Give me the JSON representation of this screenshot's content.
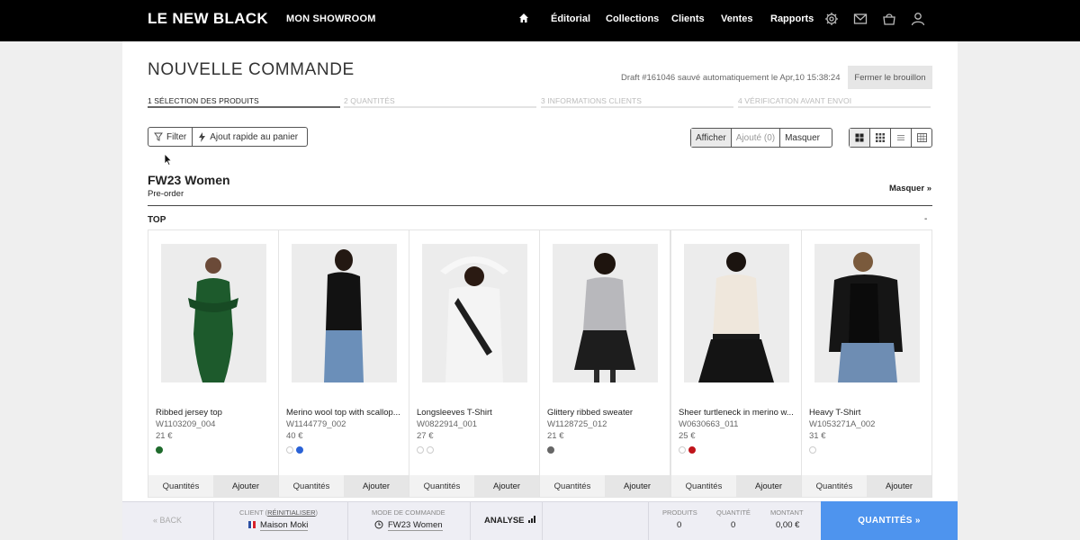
{
  "topbar": {
    "logo": "LE NEW BLACK",
    "showroom": "MON SHOWROOM",
    "nav": [
      "Éditorial",
      "Collections",
      "Clients",
      "Ventes",
      "Rapports"
    ],
    "icons": [
      "home-icon",
      "gear-icon",
      "inbox-icon",
      "cart-icon",
      "user-icon"
    ]
  },
  "header": {
    "title": "NOUVELLE COMMANDE",
    "draft_status": "Draft #161046 sauvé automatiquement le Apr,10 15:38:24",
    "close_draft": "Fermer le brouillon"
  },
  "steps": [
    {
      "label": "1 SÉLECTION DES PRODUITS",
      "active": true
    },
    {
      "label": "2 QUANTITÉS",
      "active": false
    },
    {
      "label": "3 INFORMATIONS CLIENTS",
      "active": false
    },
    {
      "label": "4 VÉRIFICATION AVANT ENVOI",
      "active": false
    }
  ],
  "toolbar": {
    "filter": "Filter",
    "quick_add": "Ajout rapide au panier",
    "show": "Afficher",
    "added": "Ajouté (0)",
    "hide": "Masquer",
    "layouts": [
      "grid-large-icon",
      "grid-small-icon",
      "list-icon",
      "table-icon"
    ]
  },
  "collection": {
    "title": "FW23 Women",
    "subtitle": "Pre-order",
    "hide_link": "Masquer »",
    "category": "TOP",
    "category_toggle": "-"
  },
  "products": [
    {
      "name": "Ribbed jersey top",
      "ref": "W1103209_004",
      "price": "21 €",
      "swatches": [
        "#1f6b2c"
      ]
    },
    {
      "name": "Merino wool top with scallop...",
      "ref": "W1144779_002",
      "price": "40 €",
      "swatches": [
        "#ffffff",
        "#2a62d6"
      ]
    },
    {
      "name": "Longsleeves T-Shirt",
      "ref": "W0822914_001",
      "price": "27 €",
      "swatches": [
        "#ffffff",
        "#ffffff"
      ]
    },
    {
      "name": "Glittery ribbed sweater",
      "ref": "W1128725_012",
      "price": "21 €",
      "swatches": [
        "#666666"
      ]
    },
    {
      "name": "Sheer turtleneck in merino w...",
      "ref": "W0630663_011",
      "price": "25 €",
      "swatches": [
        "#ffffff",
        "#c0141b"
      ]
    },
    {
      "name": "Heavy T-Shirt",
      "ref": "W1053271A_002",
      "price": "31 €",
      "swatches": [
        "#ffffff"
      ]
    }
  ],
  "card_actions": {
    "quantities": "Quantités",
    "add": "Ajouter"
  },
  "bottombar": {
    "back": "« BACK",
    "client_label": "CLIENT",
    "client_reset": "RÉINITIALISER",
    "client_name": "Maison Moki",
    "mode_label": "MODE DE COMMANDE",
    "mode_value": "FW23 Women",
    "analyse": "ANALYSE",
    "products_label": "PRODUITS",
    "products_value": "0",
    "qty_label": "QUANTITÉ",
    "qty_value": "0",
    "amount_label": "MONTANT",
    "amount_value": "0,00 €",
    "cta": "QUANTITÉS »"
  },
  "colors": {
    "accent": "#4e94ee",
    "topbar": "#000000"
  }
}
